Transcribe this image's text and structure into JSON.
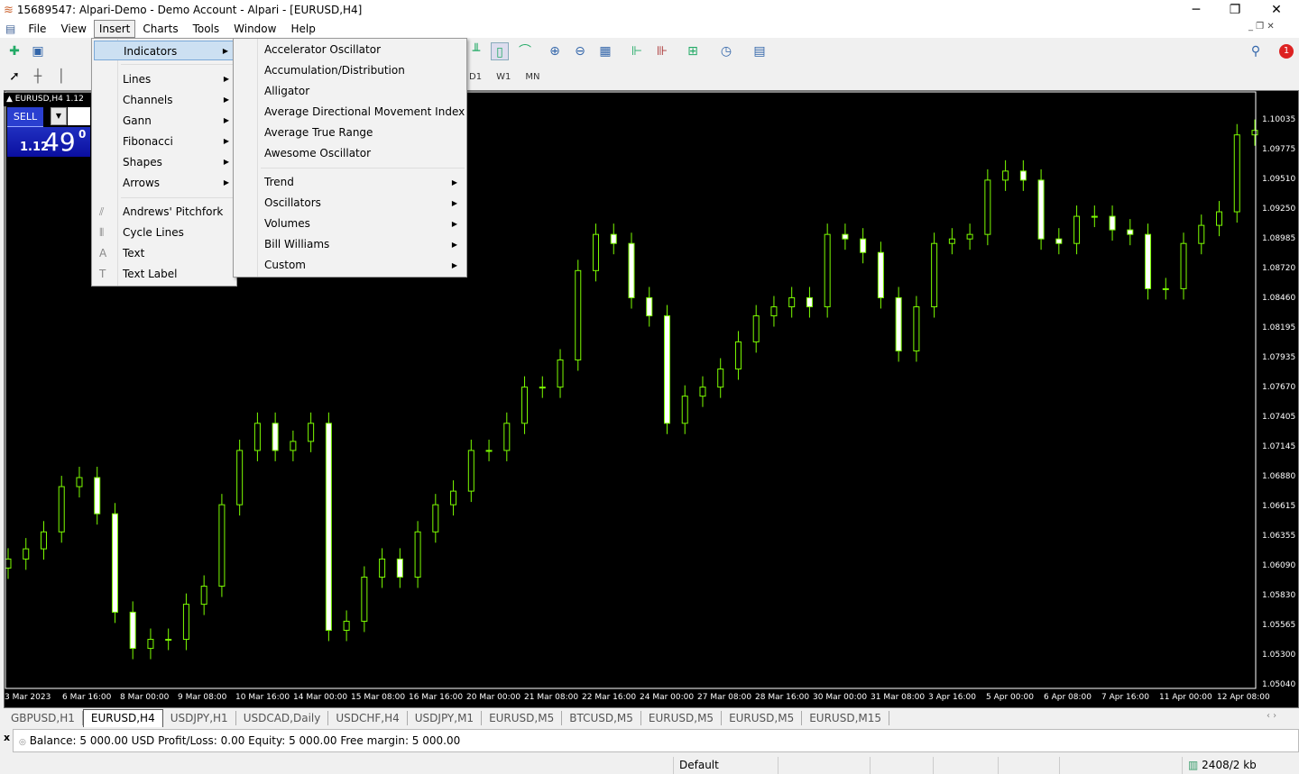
{
  "window": {
    "title": "15689547: Alpari-Demo - Demo Account - Alpari - [EURUSD,H4]",
    "minimize": "─",
    "restore": "❐",
    "close": "✕"
  },
  "menubar": [
    "File",
    "View",
    "Insert",
    "Charts",
    "Tools",
    "Window",
    "Help"
  ],
  "timeframes": [
    "D1",
    "W1",
    "MN"
  ],
  "notification_count": "1",
  "one_click": {
    "symbol_header": "▲ EURUSD,H4  1.12",
    "sell_label": "SELL",
    "price_prefix": "1.12",
    "price_big": "49",
    "price_sup": "0"
  },
  "insert_menu": {
    "items": [
      {
        "label": "Indicators",
        "submenu": true,
        "highlighted": true
      },
      {
        "label": "Lines",
        "submenu": true
      },
      {
        "label": "Channels",
        "submenu": true
      },
      {
        "label": "Gann",
        "submenu": true
      },
      {
        "label": "Fibonacci",
        "submenu": true
      },
      {
        "label": "Shapes",
        "submenu": true
      },
      {
        "label": "Arrows",
        "submenu": true
      },
      {
        "label": "Andrews' Pitchfork",
        "icon": "pitchfork-icon"
      },
      {
        "label": "Cycle Lines",
        "icon": "cycle-lines-icon"
      },
      {
        "label": "Text",
        "icon": "text-icon"
      },
      {
        "label": "Text Label",
        "icon": "text-label-icon"
      }
    ]
  },
  "indicators_menu": {
    "items": [
      {
        "label": "Accelerator Oscillator"
      },
      {
        "label": "Accumulation/Distribution"
      },
      {
        "label": "Alligator"
      },
      {
        "label": "Average Directional Movement Index"
      },
      {
        "label": "Average True Range"
      },
      {
        "label": "Awesome Oscillator"
      },
      {
        "label": "Trend",
        "submenu": true
      },
      {
        "label": "Oscillators",
        "submenu": true
      },
      {
        "label": "Volumes",
        "submenu": true
      },
      {
        "label": "Bill Williams",
        "submenu": true
      },
      {
        "label": "Custom",
        "submenu": true
      }
    ]
  },
  "chart_data": {
    "type": "candlestick",
    "symbol": "EURUSD",
    "timeframe": "H4",
    "background": "#000000",
    "candle_color": "#7CFC00",
    "ylim": [
      1.0504,
      1.10035
    ],
    "y_ticks": [
      "1.10035",
      "1.09775",
      "1.09510",
      "1.09250",
      "1.08985",
      "1.08720",
      "1.08460",
      "1.08195",
      "1.07935",
      "1.07670",
      "1.07405",
      "1.07145",
      "1.06880",
      "1.06615",
      "1.06355",
      "1.06090",
      "1.05830",
      "1.05565",
      "1.05300",
      "1.05040"
    ],
    "x_ticks": [
      "3 Mar 2023",
      "6 Mar 16:00",
      "8 Mar 00:00",
      "9 Mar 08:00",
      "10 Mar 16:00",
      "14 Mar 00:00",
      "15 Mar 08:00",
      "16 Mar 16:00",
      "20 Mar 00:00",
      "21 Mar 08:00",
      "22 Mar 16:00",
      "24 Mar 00:00",
      "27 Mar 08:00",
      "28 Mar 16:00",
      "30 Mar 00:00",
      "31 Mar 08:00",
      "3 Apr 16:00",
      "5 Apr 00:00",
      "6 Apr 08:00",
      "7 Apr 16:00",
      "11 Apr 00:00",
      "12 Apr 08:00"
    ],
    "closes": [
      1.0616,
      1.0625,
      1.064,
      1.068,
      1.0688,
      1.0656,
      1.0569,
      1.0537,
      1.0545,
      1.0545,
      1.0576,
      1.0592,
      1.0664,
      1.0712,
      1.0736,
      1.0712,
      1.072,
      1.0736,
      1.0553,
      1.0561,
      1.06,
      1.0616,
      1.06,
      1.064,
      1.0664,
      1.0676,
      1.0712,
      1.0712,
      1.0736,
      1.0768,
      1.0768,
      1.0792,
      1.0871,
      1.0903,
      1.0895,
      1.0847,
      1.0831,
      1.0736,
      1.076,
      1.0768,
      1.0784,
      1.0808,
      1.0831,
      1.0839,
      1.0847,
      1.0839,
      1.0903,
      1.0899,
      1.0887,
      1.0847,
      1.08,
      1.0839,
      1.0895,
      1.0899,
      1.0903,
      1.0951,
      1.0959,
      1.0951,
      1.0899,
      1.0895,
      1.0919,
      1.0919,
      1.0907,
      1.0903,
      1.0855,
      1.0855,
      1.0895,
      1.0911,
      1.0923,
      1.0991,
      1.0995
    ]
  },
  "tabs": [
    "GBPUSD,H1",
    "EURUSD,H4",
    "USDJPY,H1",
    "USDCAD,Daily",
    "USDCHF,H4",
    "USDJPY,M1",
    "EURUSD,M5",
    "BTCUSD,M5",
    "EURUSD,M5",
    "EURUSD,M5",
    "EURUSD,M15"
  ],
  "active_tab": "EURUSD,H4",
  "terminal": {
    "close": "x",
    "summary": "Balance: 5 000.00 USD  Profit/Loss: 0.00  Equity: 5 000.00  Free margin: 5 000.00"
  },
  "status": {
    "profile": "Default",
    "traffic": "2408/2 kb"
  }
}
